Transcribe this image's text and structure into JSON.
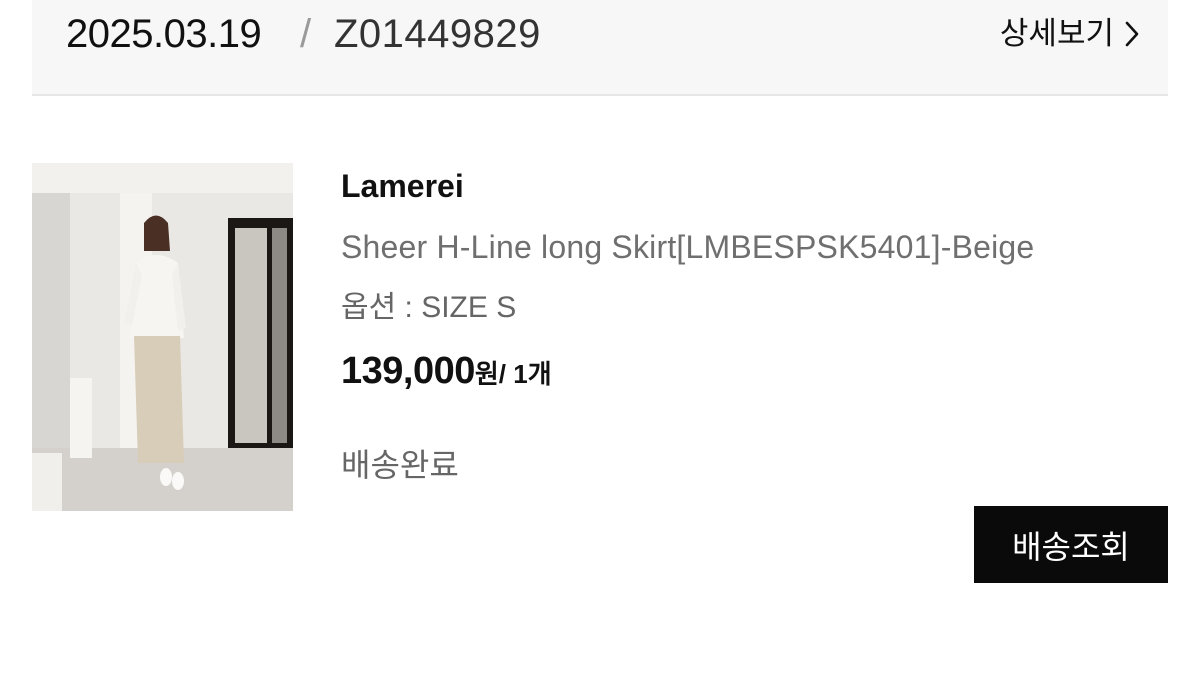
{
  "order": {
    "date": "2025.03.19",
    "separator": "/",
    "number": "Z01449829",
    "detail_label": "상세보기"
  },
  "product": {
    "brand": "Lamerei",
    "name": "Sheer H-Line long Skirt[LMBESPSK5401]-Beige",
    "option": "옵션 : SIZE S",
    "price": "139,000",
    "currency": "원",
    "quantity": "/ 1개",
    "status": "배송완료",
    "image_icon": "product-photo"
  },
  "actions": {
    "track_label": "배송조회"
  },
  "colors": {
    "header_bg": "#f7f7f7",
    "button_bg": "#0a0a0a",
    "muted_text": "#6f6f6f"
  }
}
